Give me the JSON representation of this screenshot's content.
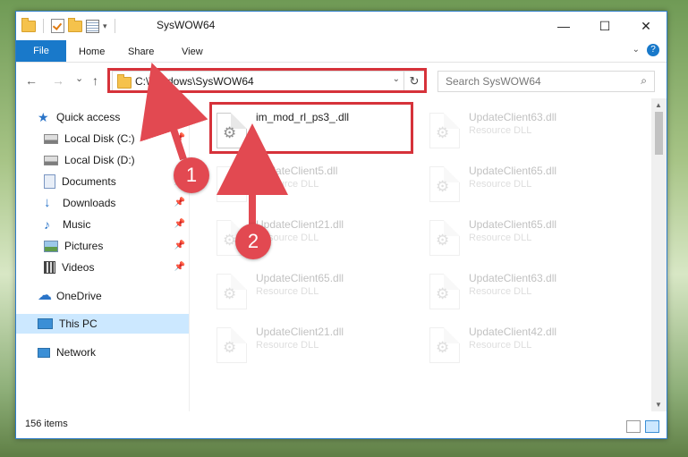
{
  "window": {
    "title": "SysWOW64"
  },
  "controls": {
    "minimize": "—",
    "maximize": "☐",
    "close": "✕"
  },
  "ribbon": {
    "tabs": [
      "File",
      "Home",
      "Share",
      "View"
    ]
  },
  "address": {
    "path": "C:\\Windows\\SysWOW64",
    "refresh": "↻"
  },
  "search": {
    "placeholder": "Search SysWOW64"
  },
  "nav_buttons": {
    "back": "←",
    "forward": "→",
    "recent": "⌄",
    "up": "↑"
  },
  "sidebar": {
    "items": [
      {
        "label": "Quick access",
        "icon": "star-icon",
        "pinned": false
      },
      {
        "label": "Local Disk (C:)",
        "icon": "drive-icon",
        "pinned": true
      },
      {
        "label": "Local Disk (D:)",
        "icon": "drive-icon",
        "pinned": false
      },
      {
        "label": "Documents",
        "icon": "documents-icon",
        "pinned": true
      },
      {
        "label": "Downloads",
        "icon": "download-icon",
        "pinned": true
      },
      {
        "label": "Music",
        "icon": "music-icon",
        "pinned": true
      },
      {
        "label": "Pictures",
        "icon": "pictures-icon",
        "pinned": true
      },
      {
        "label": "Videos",
        "icon": "video-icon",
        "pinned": true
      },
      {
        "label": "OneDrive",
        "icon": "cloud-icon",
        "pinned": false
      },
      {
        "label": "This PC",
        "icon": "computer-icon",
        "pinned": false,
        "selected": true
      },
      {
        "label": "Network",
        "icon": "network-icon",
        "pinned": false
      }
    ]
  },
  "files": [
    {
      "name": "im_mod_rl_ps3_.dll",
      "type": "",
      "highlighted": true
    },
    {
      "name": "UpdateClient63.dll",
      "type": "Resource DLL"
    },
    {
      "name": "UpdateClient5.dll",
      "type": "Resource DLL"
    },
    {
      "name": "UpdateClient65.dll",
      "type": "Resource DLL"
    },
    {
      "name": "UpdateClient21.dll",
      "type": "Resource DLL"
    },
    {
      "name": "UpdateClient65.dll",
      "type": "Resource DLL"
    },
    {
      "name": "UpdateClient65.dll",
      "type": "Resource DLL"
    },
    {
      "name": "UpdateClient63.dll",
      "type": "Resource DLL"
    },
    {
      "name": "UpdateClient21.dll",
      "type": "Resource DLL"
    },
    {
      "name": "UpdateClient42.dll",
      "type": "Resource DLL"
    }
  ],
  "status": {
    "count": "156 items"
  },
  "callouts": [
    "1",
    "2"
  ],
  "colors": {
    "accent": "#1979ca",
    "highlight": "#d6323a",
    "callout": "#e24951",
    "selected": "#cce8ff"
  }
}
